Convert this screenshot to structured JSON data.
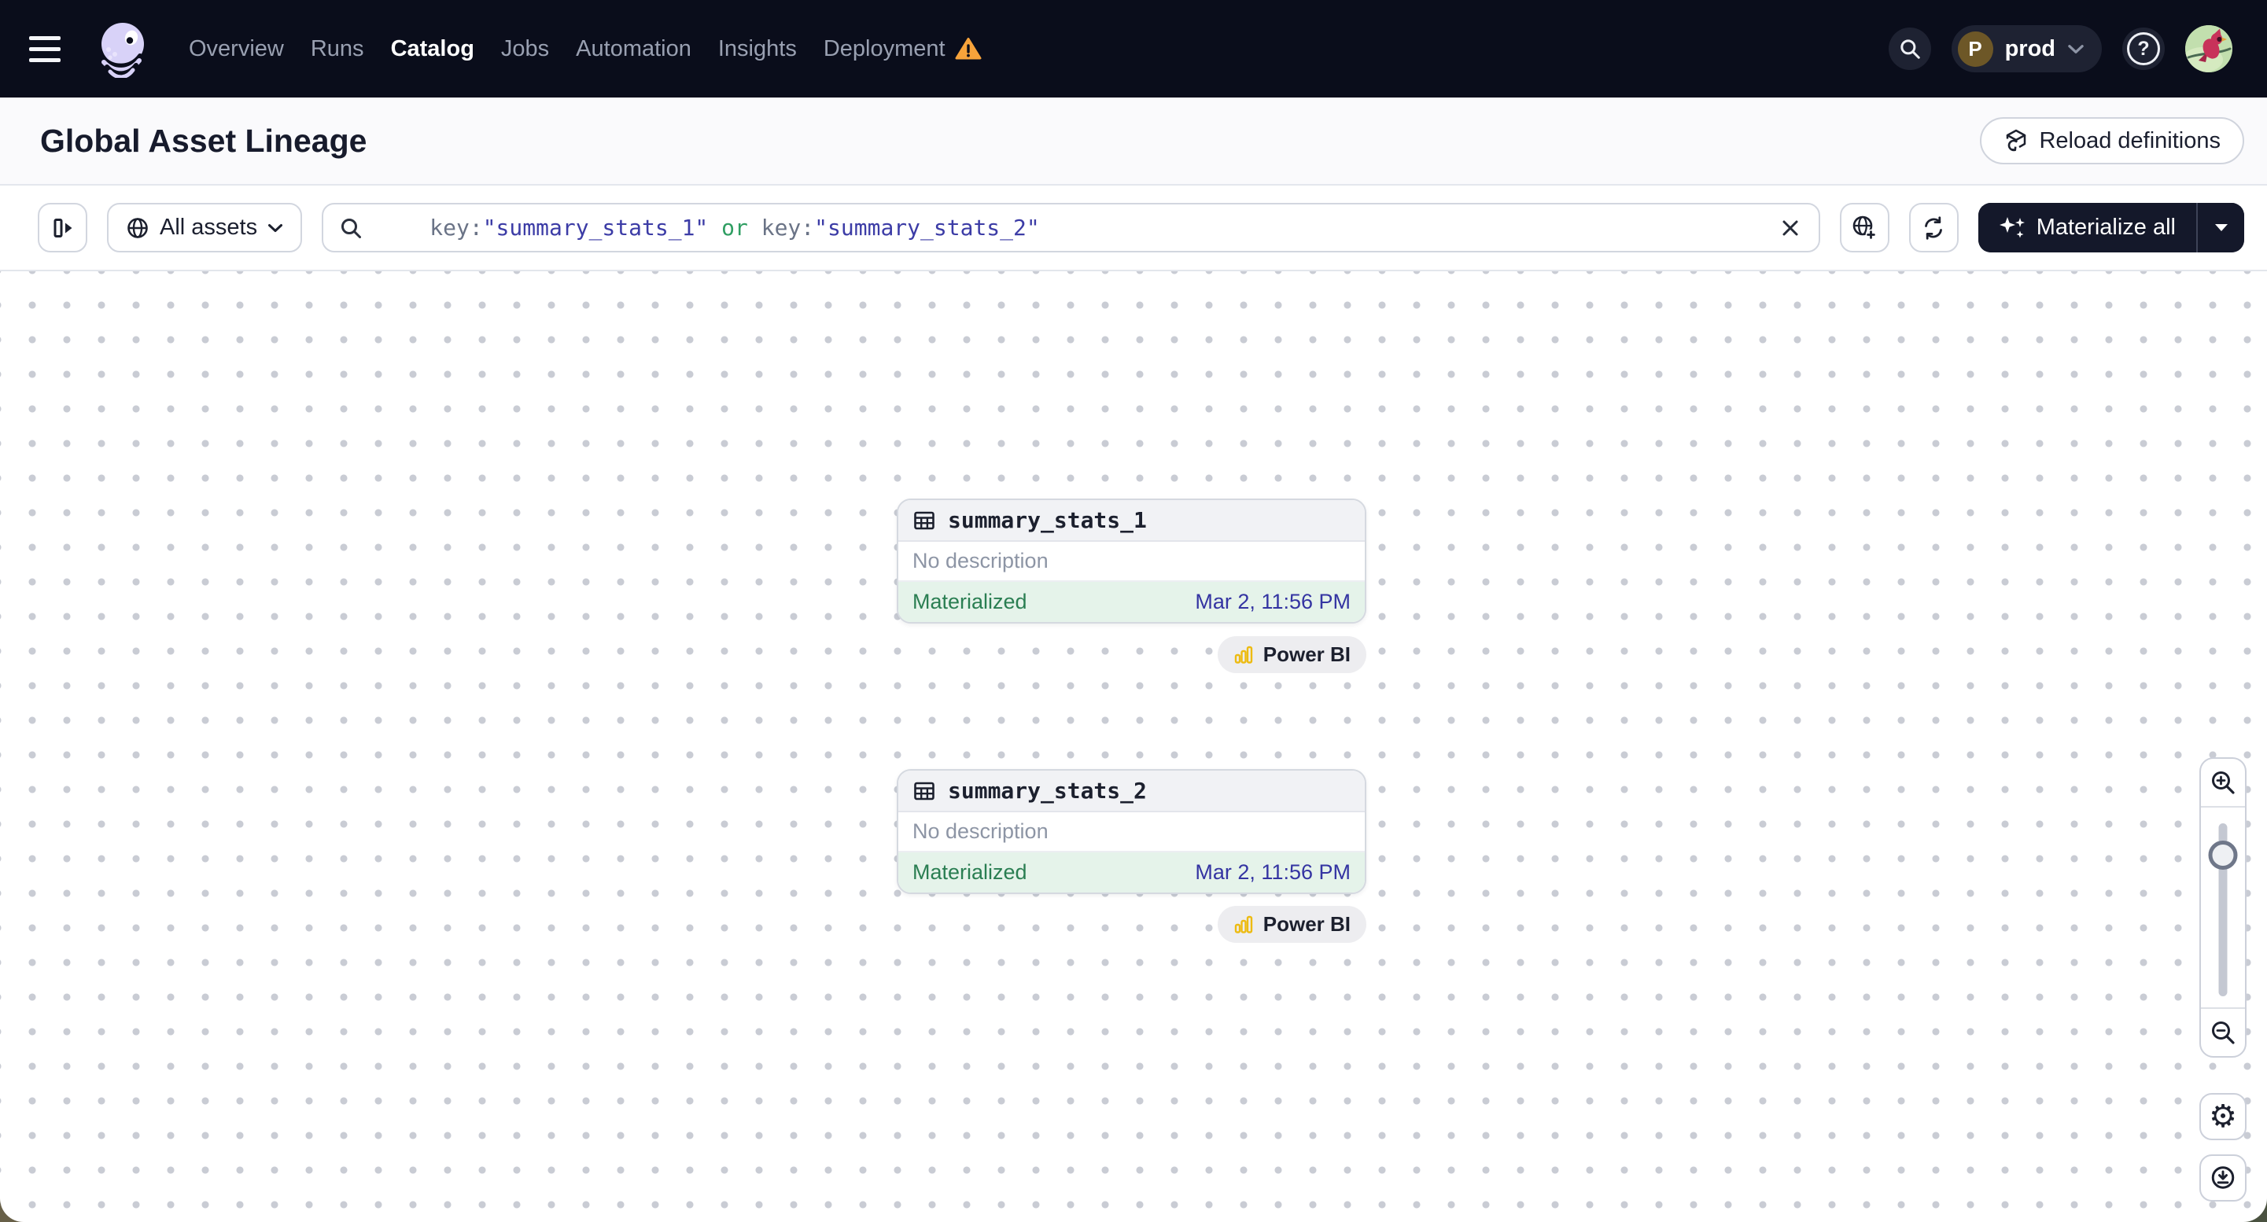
{
  "nav": {
    "items": [
      {
        "label": "Overview"
      },
      {
        "label": "Runs"
      },
      {
        "label": "Catalog"
      },
      {
        "label": "Jobs"
      },
      {
        "label": "Automation"
      },
      {
        "label": "Insights"
      },
      {
        "label": "Deployment"
      }
    ],
    "environment": {
      "initial": "P",
      "label": "prod"
    }
  },
  "header": {
    "title": "Global Asset Lineage",
    "reload_label": "Reload definitions"
  },
  "toolbar": {
    "filter_label": "All assets",
    "query": [
      {
        "text": "key:",
        "type": "key"
      },
      {
        "text": "\"summary_stats_1\"",
        "type": "value"
      },
      {
        "text": " or ",
        "type": "operator"
      },
      {
        "text": "key:",
        "type": "key"
      },
      {
        "text": "\"summary_stats_2\"",
        "type": "value"
      }
    ],
    "materialize_label": "Materialize all"
  },
  "graph": {
    "nodes": [
      {
        "name": "summary_stats_1",
        "description": "No description",
        "status": "Materialized",
        "materialized_at": "Mar 2, 11:56 PM",
        "kind_tag": "Power BI"
      },
      {
        "name": "summary_stats_2",
        "description": "No description",
        "status": "Materialized",
        "materialized_at": "Mar 2, 11:56 PM",
        "kind_tag": "Power BI"
      }
    ]
  },
  "icons": {
    "gear": "⚙",
    "help": "?"
  },
  "colors": {
    "nav_bg": "#0a0d1b",
    "warning_orange": "#f7a33b",
    "materialized_green": "#2a7e52",
    "status_bg": "#e5f3ea",
    "timestamp_blue": "#3434a2",
    "query_value_indigo": "#3c3ca6",
    "query_operator_green": "#2f9e62",
    "powerbi_yellow": "#edbb12",
    "accent_dark": "#14182a"
  }
}
